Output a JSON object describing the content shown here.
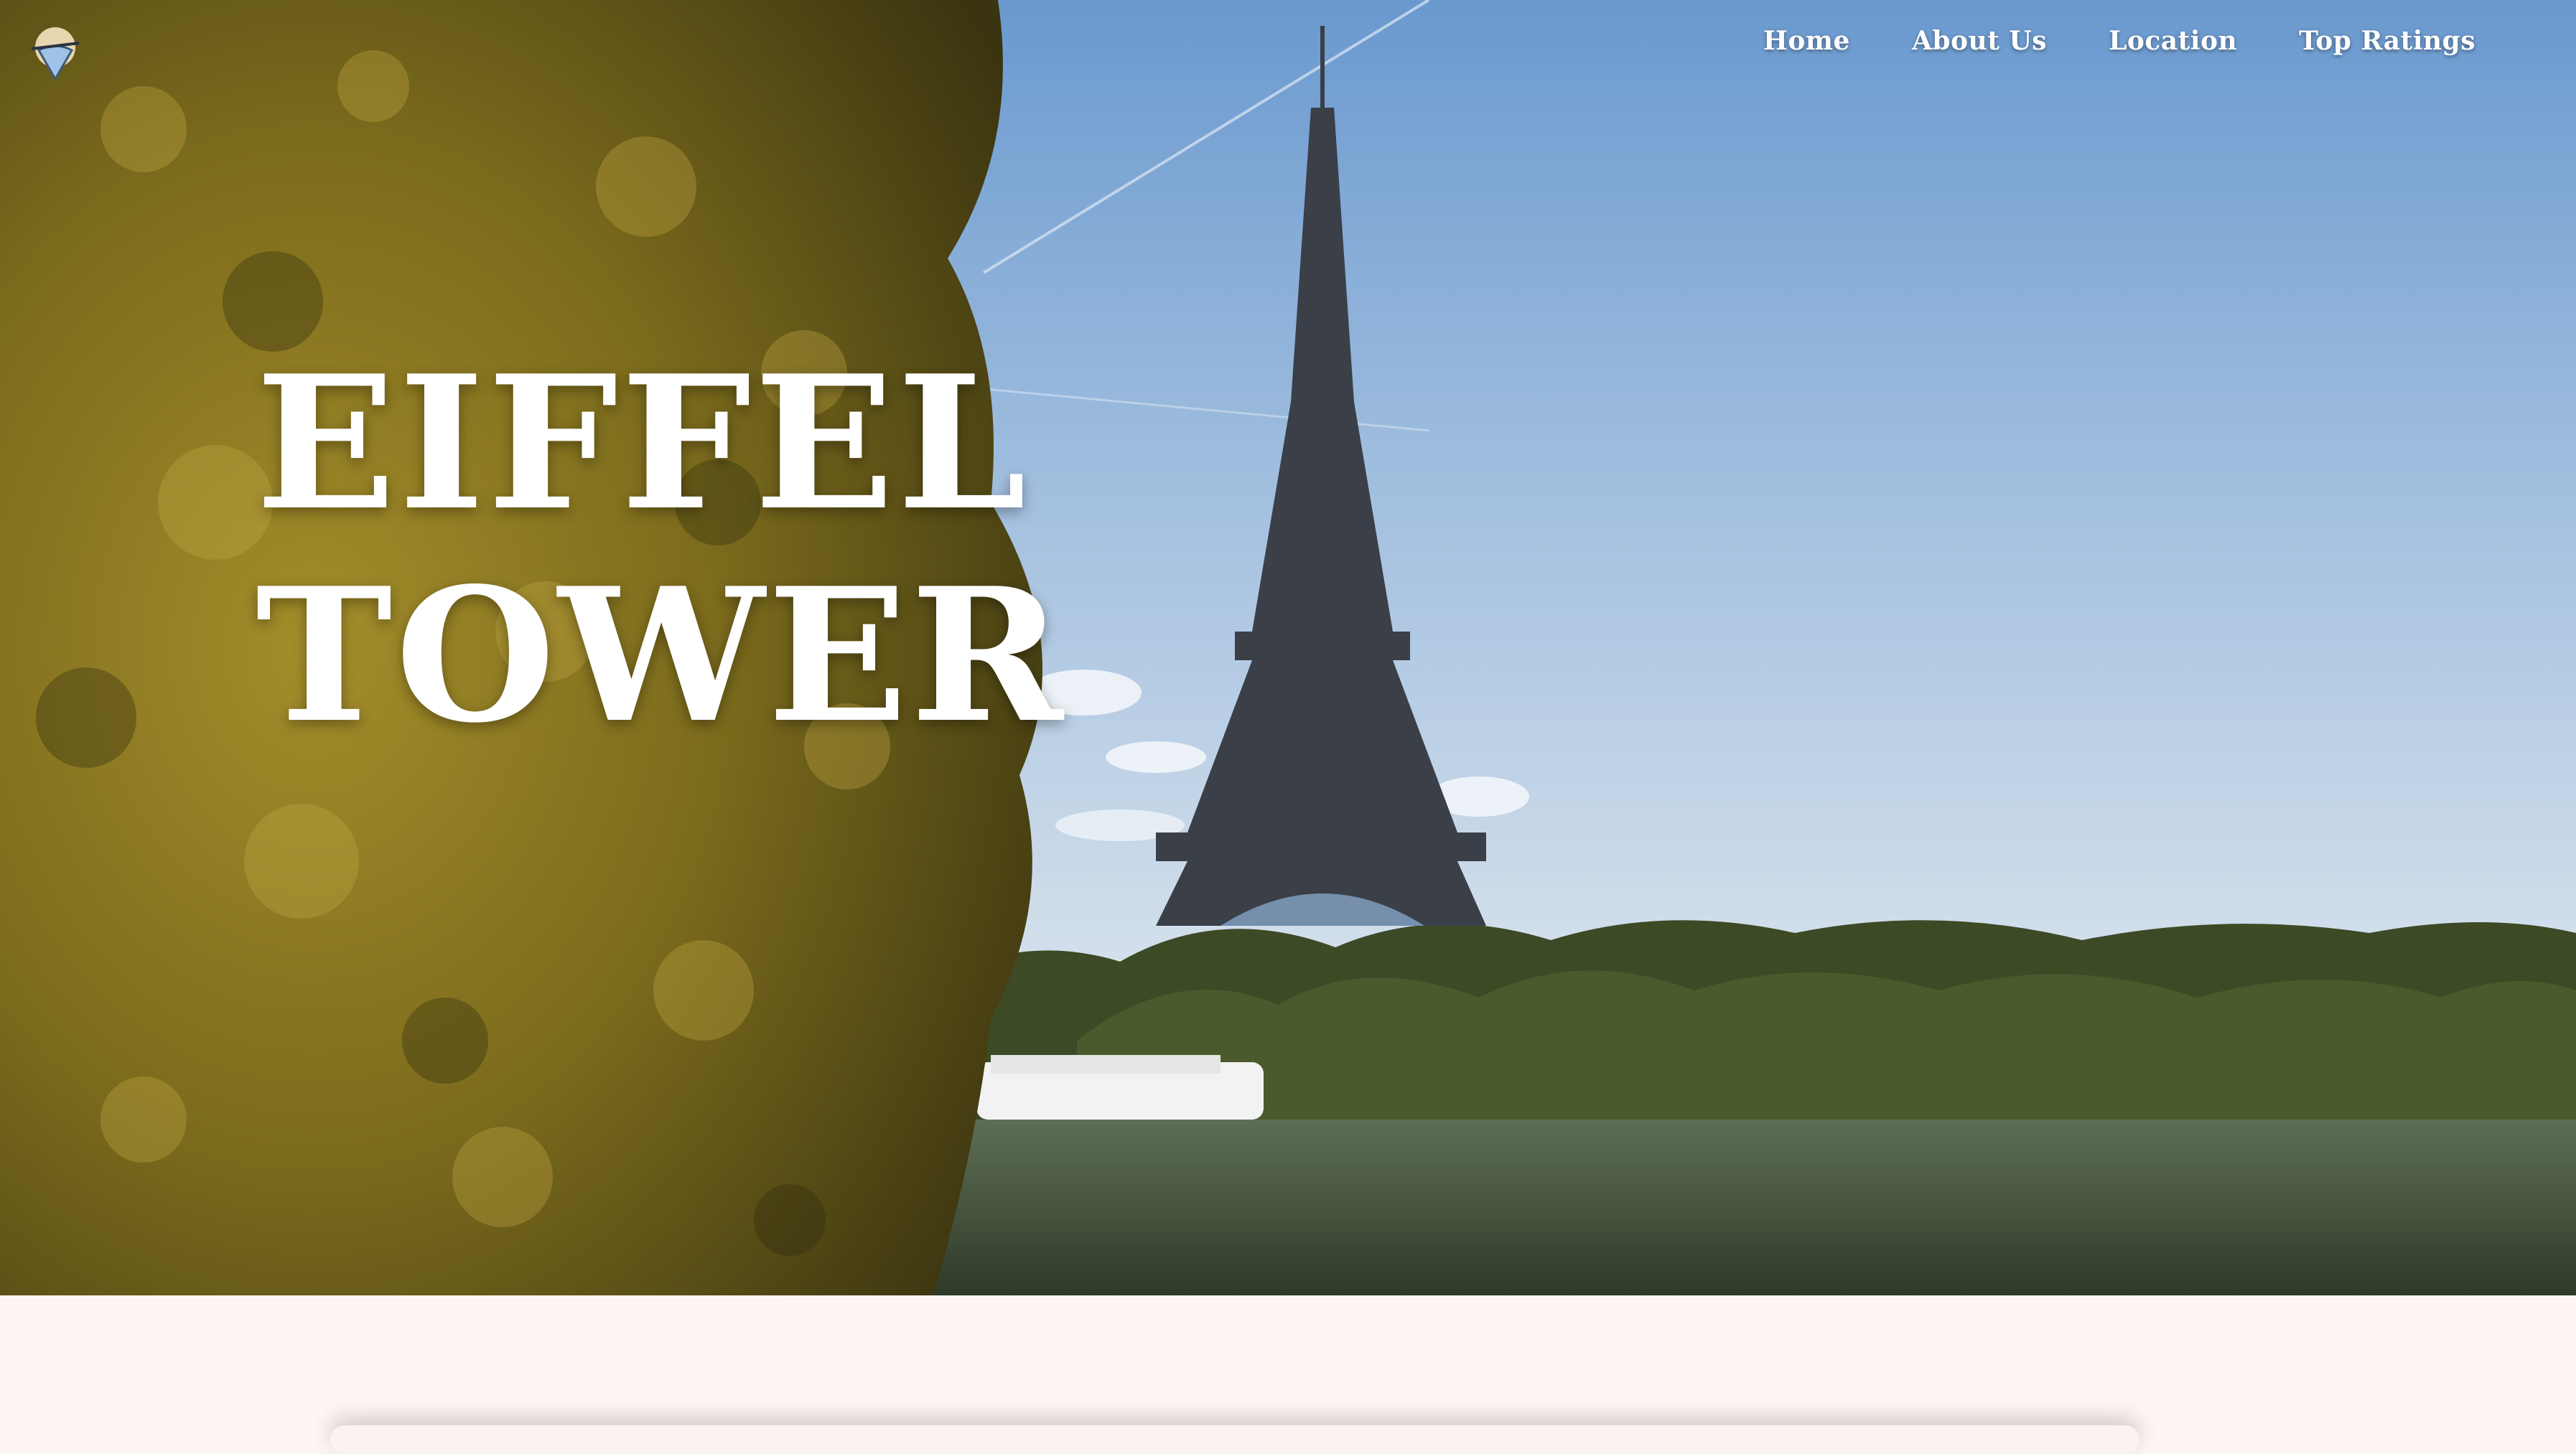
{
  "header": {
    "logo": {
      "icon": "shield-pin-logo-icon"
    },
    "nav": [
      {
        "label": "Home"
      },
      {
        "label": "About Us"
      },
      {
        "label": "Location"
      },
      {
        "label": "Top Ratings"
      }
    ]
  },
  "hero": {
    "title_line1": "EIFFEL",
    "title_line2": "TOWER",
    "image": "eiffel-tower-seine-photo"
  },
  "colors": {
    "hero_text": "#ffffff",
    "page_background": "#fdf6f3"
  }
}
